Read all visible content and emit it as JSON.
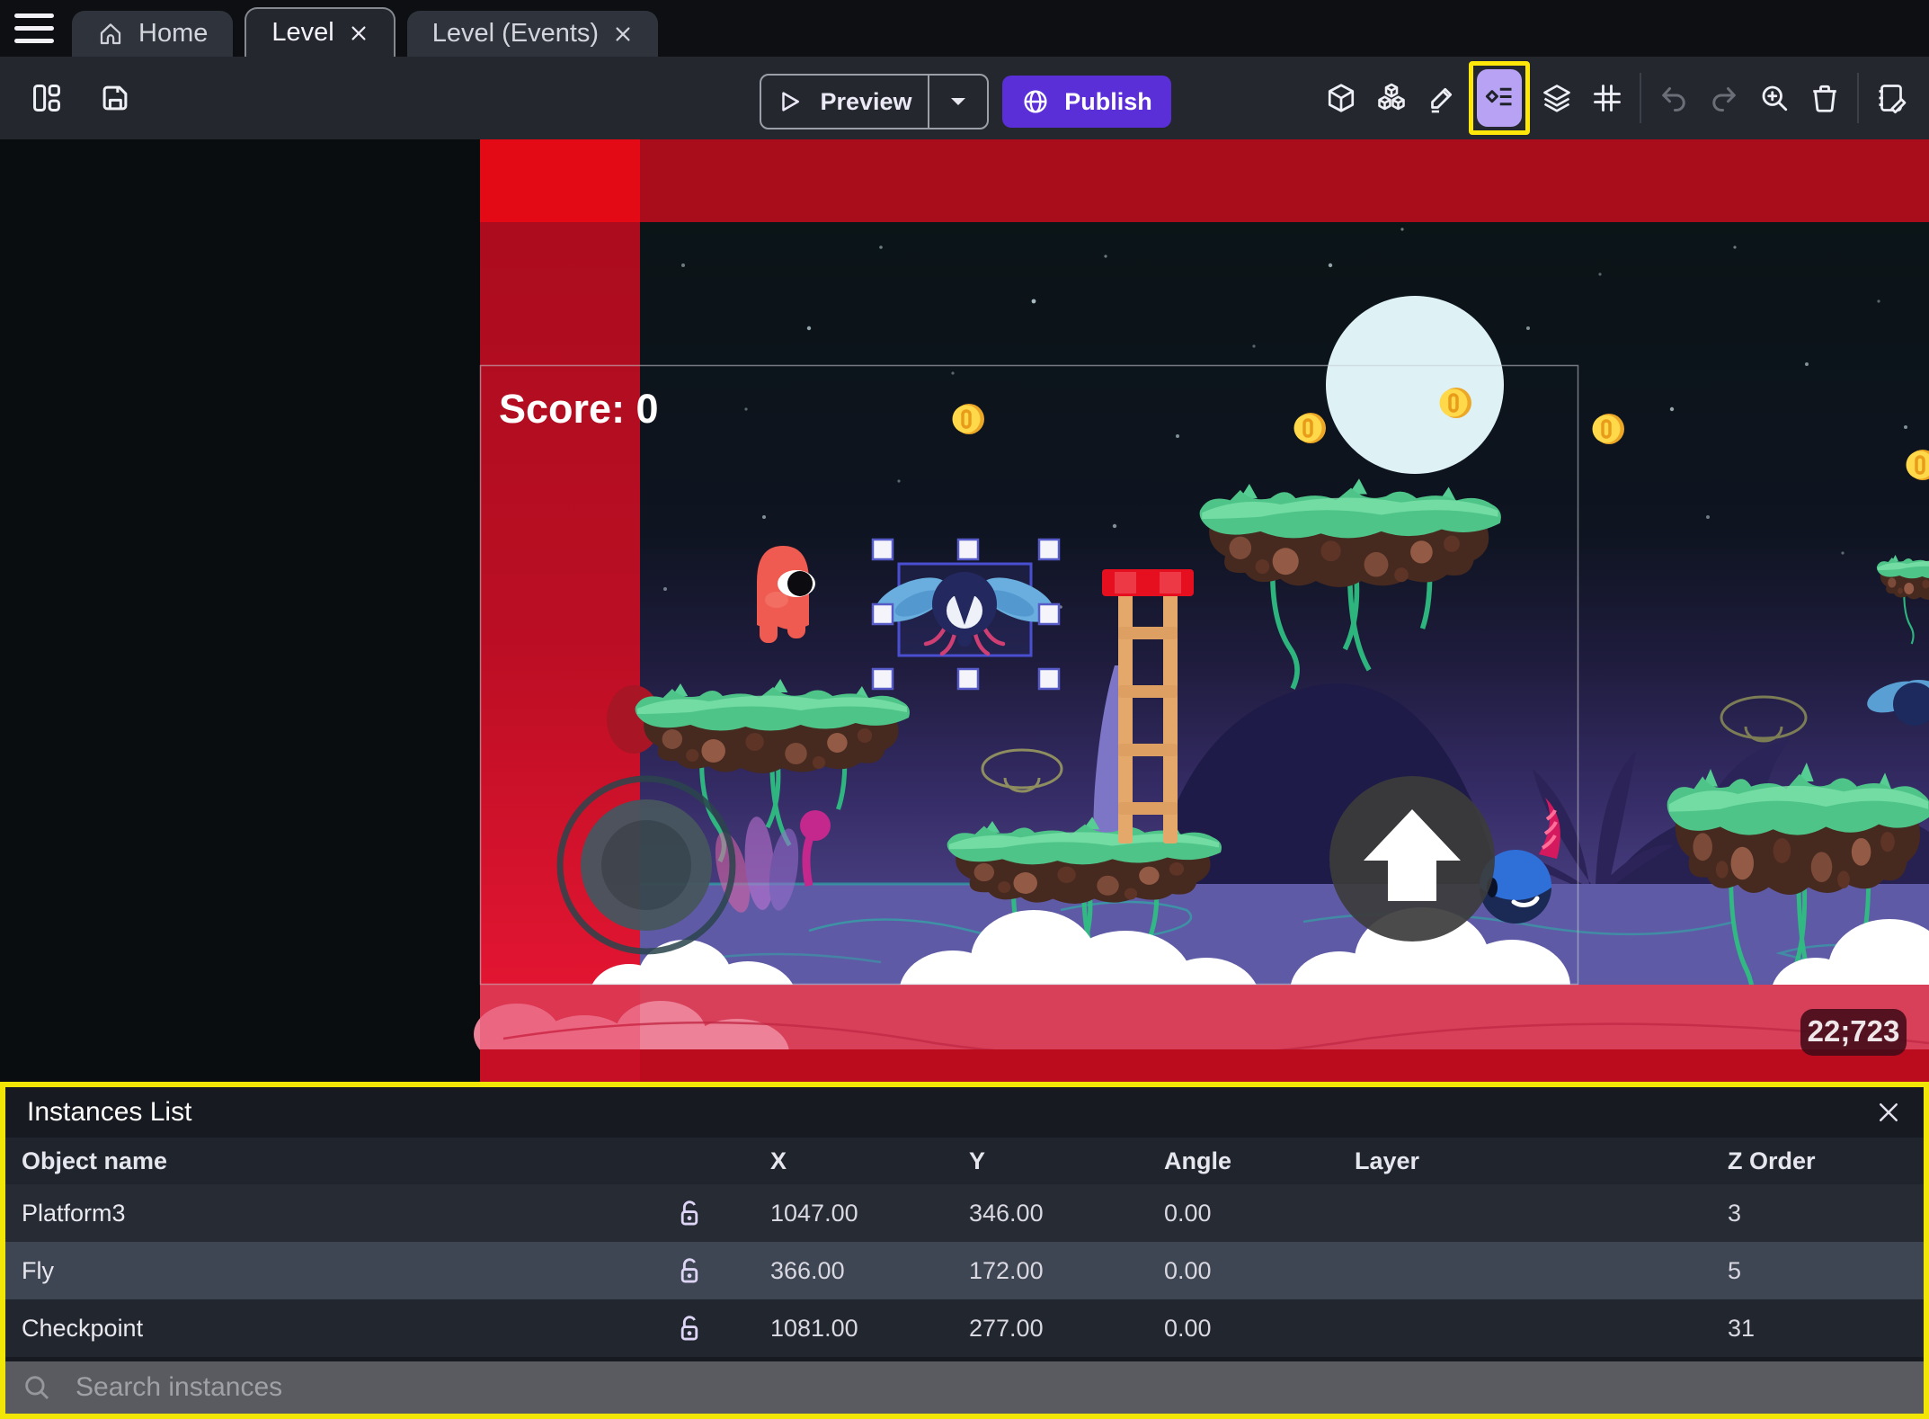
{
  "tabs": {
    "home": "Home",
    "level": "Level",
    "level_events": "Level (Events)"
  },
  "toolbar": {
    "preview_label": "Preview",
    "publish_label": "Publish",
    "icons": [
      "layout-icon",
      "save-icon",
      "cube-3d-icon",
      "objects-icon",
      "pencil-icon",
      "instances-list-icon",
      "layers-icon",
      "grid-icon",
      "undo-icon",
      "redo-icon",
      "zoom-in-icon",
      "trash-icon",
      "scene-properties-icon"
    ]
  },
  "scene": {
    "score_text": "Score: 0",
    "coords_badge": "22;723"
  },
  "panel": {
    "title": "Instances List",
    "columns": {
      "name": "Object name",
      "x": "X",
      "y": "Y",
      "angle": "Angle",
      "layer": "Layer",
      "z": "Z Order"
    },
    "rows": [
      {
        "name": "Platform3",
        "x": "1047.00",
        "y": "346.00",
        "angle": "0.00",
        "layer": "",
        "z": "3"
      },
      {
        "name": "Fly",
        "x": "366.00",
        "y": "172.00",
        "angle": "0.00",
        "layer": "",
        "z": "5"
      },
      {
        "name": "Checkpoint",
        "x": "1081.00",
        "y": "277.00",
        "angle": "0.00",
        "layer": "",
        "z": "31"
      }
    ],
    "search_placeholder": "Search instances"
  },
  "colors": {
    "accent_purple": "#5a2fd8",
    "highlight_yellow": "#ffe70a",
    "selection_blue": "#4a4fd2",
    "red_band": "#e30a16",
    "panel_bg": "#171a20"
  }
}
